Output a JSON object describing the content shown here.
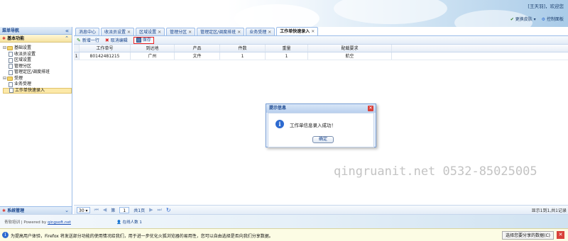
{
  "header": {
    "user": "[王天羽]，欢迎您",
    "links": [
      "更换皮肤",
      "控制面板"
    ]
  },
  "sidebar": {
    "title": "菜单导航",
    "section": "基本功能",
    "tree": [
      {
        "label": "基础设置",
        "type": "folder",
        "level": 0
      },
      {
        "label": "收派员设置",
        "type": "doc",
        "level": 1
      },
      {
        "label": "区域设置",
        "type": "doc",
        "level": 1
      },
      {
        "label": "管理分区",
        "type": "doc",
        "level": 1
      },
      {
        "label": "管理定区/调度排班",
        "type": "doc",
        "level": 1
      },
      {
        "label": "受理",
        "type": "folder",
        "level": 0
      },
      {
        "label": "业务受理",
        "type": "doc",
        "level": 1
      },
      {
        "label": "工作单快速录入",
        "type": "doc",
        "level": 1,
        "selected": true
      }
    ],
    "bottom": "系统管理"
  },
  "tabs": [
    {
      "label": "消息中心",
      "closable": false
    },
    {
      "label": "收派员设置",
      "closable": true
    },
    {
      "label": "区域设置",
      "closable": true
    },
    {
      "label": "管理分区",
      "closable": true
    },
    {
      "label": "管理定区/调度排班",
      "closable": true
    },
    {
      "label": "业务受理",
      "closable": true
    },
    {
      "label": "工作单快速录入",
      "closable": true,
      "active": true
    }
  ],
  "toolbar": {
    "add_label": "新增一行",
    "cancel_label": "取消编辑",
    "save_label": "保存"
  },
  "grid": {
    "columns": [
      "工作单号",
      "到达地",
      "产品",
      "件数",
      "重量",
      "配载要求"
    ],
    "rows": [
      [
        "1",
        "80142481215",
        "广州",
        "文件",
        "1",
        "1",
        "航空"
      ]
    ]
  },
  "pager": {
    "page_size": "30",
    "page_prefix": "第",
    "page_value": "1",
    "page_suffix": "共1页",
    "info": "显示1到1,共1记录"
  },
  "dialog": {
    "title": "提示信息",
    "message": "工作单信息录入成功！",
    "ok_label": "确定"
  },
  "watermark": "qingruanit.net 0532-85025005",
  "footer": {
    "copy_prefix": "青软培训 | Powered by ",
    "copy_link": "qingsoft.net",
    "online": "在线人数 1"
  },
  "notification": {
    "text": "为提高用户体验，Firefox 将发送部分功能的使用情况给我们，用于进一步优化火狐浏览器的易用性，您可以自由选择是否向我们分享数据。",
    "button": "选择您要分享的数据(C)"
  }
}
